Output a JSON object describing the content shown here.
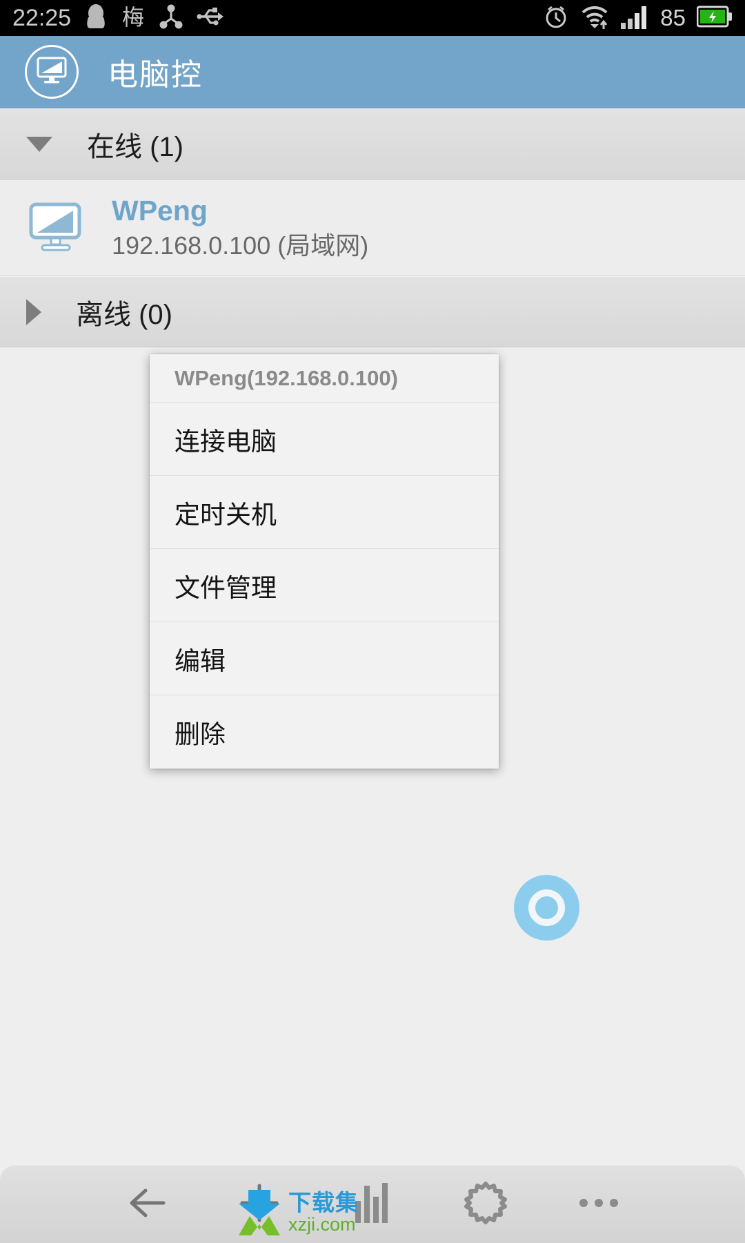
{
  "status_bar": {
    "time": "22:25",
    "battery_percent": "85",
    "icons": [
      "qq-penguin-icon",
      "ime-mei-icon",
      "share-nodes-icon",
      "usb-icon",
      "alarm-clock-icon",
      "wifi-icon",
      "signal-bars-icon",
      "battery-charging-icon"
    ]
  },
  "app_bar": {
    "title": "电脑控",
    "logo_icon": "monitor-icon",
    "background_color": "#73a4c9"
  },
  "groups": [
    {
      "label": "在线 (1)",
      "expanded": true,
      "toggle_icon": "triangle-down-icon"
    },
    {
      "label": "离线 (0)",
      "expanded": false,
      "toggle_icon": "triangle-right-icon"
    }
  ],
  "device": {
    "icon": "monitor-icon",
    "name": "WPeng",
    "address": "192.168.0.100 (局域网)",
    "name_color": "#6fa5ca"
  },
  "dialog": {
    "title": "WPeng(192.168.0.100)",
    "items": [
      {
        "label": "连接电脑"
      },
      {
        "label": "定时关机"
      },
      {
        "label": "文件管理"
      },
      {
        "label": "编辑"
      },
      {
        "label": "删除"
      }
    ]
  },
  "fab": {
    "name": "power-toggle-button",
    "color": "#8ccdee"
  },
  "bottom_bar": {
    "buttons": [
      {
        "name": "back-button",
        "icon": "arrow-left-icon"
      },
      {
        "name": "add-button",
        "icon": "plus-icon"
      },
      {
        "name": "stats-button",
        "icon": "bar-chart-icon"
      },
      {
        "name": "settings-button",
        "icon": "gear-icon"
      },
      {
        "name": "more-button",
        "icon": "ellipsis-icon"
      }
    ]
  },
  "watermark": {
    "title": "下载集",
    "url": "xzji.com"
  }
}
